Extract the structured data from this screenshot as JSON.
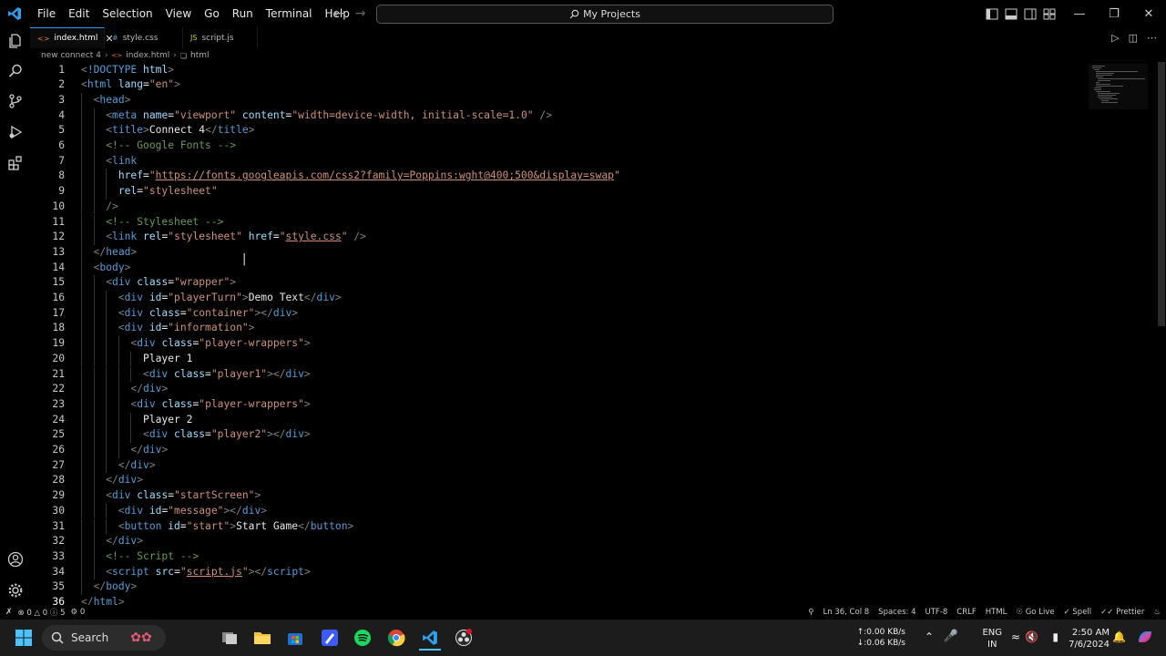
{
  "menu": [
    "File",
    "Edit",
    "Selection",
    "View",
    "Go",
    "Run",
    "Terminal",
    "Help"
  ],
  "command_center": "My Projects",
  "tabs": [
    {
      "label": "index.html",
      "icon": "html-file-icon",
      "active": true
    },
    {
      "label": "style.css",
      "icon": "css-file-icon",
      "active": false
    },
    {
      "label": "script.js",
      "icon": "js-file-icon",
      "active": false
    }
  ],
  "breadcrumb": [
    "new connect 4",
    "index.html",
    "html"
  ],
  "code_lines": [
    {
      "num": "1",
      "segs": [
        [
          "t",
          "<"
        ],
        [
          "n",
          "!DOCTYPE"
        ],
        [
          "a",
          " html"
        ],
        [
          "t",
          ">"
        ]
      ]
    },
    {
      "num": "2",
      "segs": [
        [
          "t",
          "<"
        ],
        [
          "n",
          "html"
        ],
        [
          "a",
          " lang"
        ],
        [
          "x",
          "="
        ],
        [
          "s",
          "\"en\""
        ],
        [
          "t",
          ">"
        ]
      ]
    },
    {
      "num": "3",
      "segs": [
        [
          "x",
          "  "
        ],
        [
          "t",
          "<"
        ],
        [
          "n",
          "head"
        ],
        [
          "t",
          ">"
        ]
      ]
    },
    {
      "num": "4",
      "segs": [
        [
          "x",
          "    "
        ],
        [
          "t",
          "<"
        ],
        [
          "n",
          "meta"
        ],
        [
          "a",
          " name"
        ],
        [
          "x",
          "="
        ],
        [
          "s",
          "\"viewport\""
        ],
        [
          "a",
          " content"
        ],
        [
          "x",
          "="
        ],
        [
          "s",
          "\"width=device-width, initial-scale=1.0\""
        ],
        [
          "t",
          " />"
        ]
      ]
    },
    {
      "num": "5",
      "segs": [
        [
          "x",
          "    "
        ],
        [
          "t",
          "<"
        ],
        [
          "n",
          "title"
        ],
        [
          "t",
          ">"
        ],
        [
          "x",
          "Connect 4"
        ],
        [
          "t",
          "</"
        ],
        [
          "n",
          "title"
        ],
        [
          "t",
          ">"
        ]
      ]
    },
    {
      "num": "6",
      "segs": [
        [
          "x",
          "    "
        ],
        [
          "c",
          "<!-- Google Fonts -->"
        ]
      ]
    },
    {
      "num": "7",
      "segs": [
        [
          "x",
          "    "
        ],
        [
          "t",
          "<"
        ],
        [
          "n",
          "link"
        ]
      ]
    },
    {
      "num": "8",
      "segs": [
        [
          "x",
          "      "
        ],
        [
          "a",
          "href"
        ],
        [
          "x",
          "="
        ],
        [
          "s",
          "\""
        ],
        [
          "u",
          "https://fonts.googleapis.com/css2?family=Poppins:wght@400;500&display=swap"
        ],
        [
          "s",
          "\""
        ]
      ]
    },
    {
      "num": "9",
      "segs": [
        [
          "x",
          "      "
        ],
        [
          "a",
          "rel"
        ],
        [
          "x",
          "="
        ],
        [
          "s",
          "\"stylesheet\""
        ]
      ]
    },
    {
      "num": "10",
      "segs": [
        [
          "x",
          "    "
        ],
        [
          "t",
          "/>"
        ]
      ]
    },
    {
      "num": "11",
      "segs": [
        [
          "x",
          "    "
        ],
        [
          "c",
          "<!-- Stylesheet -->"
        ]
      ]
    },
    {
      "num": "12",
      "segs": [
        [
          "x",
          "    "
        ],
        [
          "t",
          "<"
        ],
        [
          "n",
          "link"
        ],
        [
          "a",
          " rel"
        ],
        [
          "x",
          "="
        ],
        [
          "s",
          "\"stylesheet\""
        ],
        [
          "a",
          " href"
        ],
        [
          "x",
          "="
        ],
        [
          "s",
          "\""
        ],
        [
          "u",
          "style.css"
        ],
        [
          "s",
          "\""
        ],
        [
          "t",
          " />"
        ]
      ]
    },
    {
      "num": "13",
      "segs": [
        [
          "x",
          "  "
        ],
        [
          "t",
          "</"
        ],
        [
          "n",
          "head"
        ],
        [
          "t",
          ">"
        ]
      ]
    },
    {
      "num": "14",
      "segs": [
        [
          "x",
          "  "
        ],
        [
          "t",
          "<"
        ],
        [
          "n",
          "body"
        ],
        [
          "t",
          ">"
        ]
      ]
    },
    {
      "num": "15",
      "segs": [
        [
          "x",
          "    "
        ],
        [
          "t",
          "<"
        ],
        [
          "n",
          "div"
        ],
        [
          "a",
          " class"
        ],
        [
          "x",
          "="
        ],
        [
          "s",
          "\"wrapper\""
        ],
        [
          "t",
          ">"
        ]
      ]
    },
    {
      "num": "16",
      "segs": [
        [
          "x",
          "      "
        ],
        [
          "t",
          "<"
        ],
        [
          "n",
          "div"
        ],
        [
          "a",
          " id"
        ],
        [
          "x",
          "="
        ],
        [
          "s",
          "\"playerTurn\""
        ],
        [
          "t",
          ">"
        ],
        [
          "x",
          "Demo Text"
        ],
        [
          "t",
          "</"
        ],
        [
          "n",
          "div"
        ],
        [
          "t",
          ">"
        ]
      ]
    },
    {
      "num": "17",
      "segs": [
        [
          "x",
          "      "
        ],
        [
          "t",
          "<"
        ],
        [
          "n",
          "div"
        ],
        [
          "a",
          " class"
        ],
        [
          "x",
          "="
        ],
        [
          "s",
          "\"container\""
        ],
        [
          "t",
          "></"
        ],
        [
          "n",
          "div"
        ],
        [
          "t",
          ">"
        ]
      ]
    },
    {
      "num": "18",
      "segs": [
        [
          "x",
          "      "
        ],
        [
          "t",
          "<"
        ],
        [
          "n",
          "div"
        ],
        [
          "a",
          " id"
        ],
        [
          "x",
          "="
        ],
        [
          "s",
          "\"information\""
        ],
        [
          "t",
          ">"
        ]
      ]
    },
    {
      "num": "19",
      "segs": [
        [
          "x",
          "        "
        ],
        [
          "t",
          "<"
        ],
        [
          "n",
          "div"
        ],
        [
          "a",
          " class"
        ],
        [
          "x",
          "="
        ],
        [
          "s",
          "\"player-wrappers\""
        ],
        [
          "t",
          ">"
        ]
      ]
    },
    {
      "num": "20",
      "segs": [
        [
          "x",
          "          Player 1"
        ]
      ]
    },
    {
      "num": "21",
      "segs": [
        [
          "x",
          "          "
        ],
        [
          "t",
          "<"
        ],
        [
          "n",
          "div"
        ],
        [
          "a",
          " class"
        ],
        [
          "x",
          "="
        ],
        [
          "s",
          "\"player1\""
        ],
        [
          "t",
          "></"
        ],
        [
          "n",
          "div"
        ],
        [
          "t",
          ">"
        ]
      ]
    },
    {
      "num": "22",
      "segs": [
        [
          "x",
          "        "
        ],
        [
          "t",
          "</"
        ],
        [
          "n",
          "div"
        ],
        [
          "t",
          ">"
        ]
      ]
    },
    {
      "num": "23",
      "segs": [
        [
          "x",
          "        "
        ],
        [
          "t",
          "<"
        ],
        [
          "n",
          "div"
        ],
        [
          "a",
          " class"
        ],
        [
          "x",
          "="
        ],
        [
          "s",
          "\"player-wrappers\""
        ],
        [
          "t",
          ">"
        ]
      ]
    },
    {
      "num": "24",
      "segs": [
        [
          "x",
          "          Player 2"
        ]
      ]
    },
    {
      "num": "25",
      "segs": [
        [
          "x",
          "          "
        ],
        [
          "t",
          "<"
        ],
        [
          "n",
          "div"
        ],
        [
          "a",
          " class"
        ],
        [
          "x",
          "="
        ],
        [
          "s",
          "\"player2\""
        ],
        [
          "t",
          "></"
        ],
        [
          "n",
          "div"
        ],
        [
          "t",
          ">"
        ]
      ]
    },
    {
      "num": "26",
      "segs": [
        [
          "x",
          "        "
        ],
        [
          "t",
          "</"
        ],
        [
          "n",
          "div"
        ],
        [
          "t",
          ">"
        ]
      ]
    },
    {
      "num": "27",
      "segs": [
        [
          "x",
          "      "
        ],
        [
          "t",
          "</"
        ],
        [
          "n",
          "div"
        ],
        [
          "t",
          ">"
        ]
      ]
    },
    {
      "num": "28",
      "segs": [
        [
          "x",
          "    "
        ],
        [
          "t",
          "</"
        ],
        [
          "n",
          "div"
        ],
        [
          "t",
          ">"
        ]
      ]
    },
    {
      "num": "29",
      "segs": [
        [
          "x",
          "    "
        ],
        [
          "t",
          "<"
        ],
        [
          "n",
          "div"
        ],
        [
          "a",
          " class"
        ],
        [
          "x",
          "="
        ],
        [
          "s",
          "\"startScreen\""
        ],
        [
          "t",
          ">"
        ]
      ]
    },
    {
      "num": "30",
      "segs": [
        [
          "x",
          "      "
        ],
        [
          "t",
          "<"
        ],
        [
          "n",
          "div"
        ],
        [
          "a",
          " id"
        ],
        [
          "x",
          "="
        ],
        [
          "s",
          "\"message\""
        ],
        [
          "t",
          "></"
        ],
        [
          "n",
          "div"
        ],
        [
          "t",
          ">"
        ]
      ]
    },
    {
      "num": "31",
      "segs": [
        [
          "x",
          "      "
        ],
        [
          "t",
          "<"
        ],
        [
          "n",
          "button"
        ],
        [
          "a",
          " id"
        ],
        [
          "x",
          "="
        ],
        [
          "s",
          "\"start\""
        ],
        [
          "t",
          ">"
        ],
        [
          "x",
          "Start Game"
        ],
        [
          "t",
          "</"
        ],
        [
          "n",
          "button"
        ],
        [
          "t",
          ">"
        ]
      ]
    },
    {
      "num": "32",
      "segs": [
        [
          "x",
          "    "
        ],
        [
          "t",
          "</"
        ],
        [
          "n",
          "div"
        ],
        [
          "t",
          ">"
        ]
      ]
    },
    {
      "num": "33",
      "segs": [
        [
          "x",
          "    "
        ],
        [
          "c",
          "<!-- Script -->"
        ]
      ]
    },
    {
      "num": "34",
      "segs": [
        [
          "x",
          "    "
        ],
        [
          "t",
          "<"
        ],
        [
          "n",
          "script"
        ],
        [
          "a",
          " src"
        ],
        [
          "x",
          "="
        ],
        [
          "s",
          "\""
        ],
        [
          "u",
          "script.js"
        ],
        [
          "s",
          "\""
        ],
        [
          "t",
          "></"
        ],
        [
          "n",
          "script"
        ],
        [
          "t",
          ">"
        ]
      ]
    },
    {
      "num": "35",
      "segs": [
        [
          "x",
          "  "
        ],
        [
          "t",
          "</"
        ],
        [
          "n",
          "body"
        ],
        [
          "t",
          ">"
        ]
      ]
    },
    {
      "num": "36",
      "segs": [
        [
          "t",
          "</"
        ],
        [
          "n",
          "html"
        ],
        [
          "t",
          ">"
        ]
      ]
    }
  ],
  "status": {
    "errors": "0",
    "warnings": "0",
    "info": "5",
    "ports": "0",
    "position": "Ln 36, Col 8",
    "spaces": "Spaces: 4",
    "encoding": "UTF-8",
    "eol": "CRLF",
    "language": "HTML",
    "golive": "Go Live",
    "spell": "Spell",
    "prettier": "Prettier"
  },
  "taskbar": {
    "search": "Search",
    "net_up": "0.00 KB/s",
    "net_down": "0.06 KB/s",
    "lang1": "ENG",
    "lang2": "IN",
    "time": "2:50 AM",
    "date": "7/6/2024"
  },
  "colors": {
    "accent": "#3794ff",
    "keyword": "#569cd6",
    "attr": "#9cdcfe",
    "string": "#ce9178",
    "comment": "#6a9955"
  }
}
